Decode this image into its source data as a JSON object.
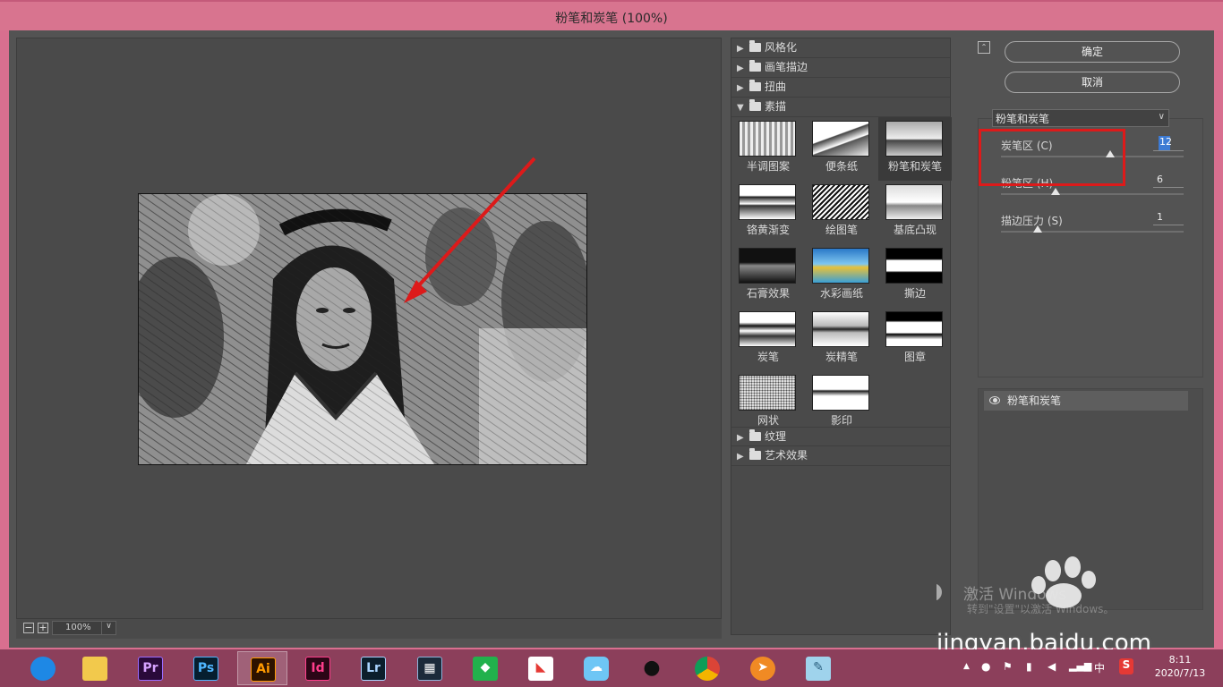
{
  "window": {
    "title": "粉笔和炭笔 (100%)"
  },
  "preview": {
    "zoom": "100%"
  },
  "gallery": {
    "categories_top": [
      {
        "label": "风格化",
        "expanded": false
      },
      {
        "label": "画笔描边",
        "expanded": false
      },
      {
        "label": "扭曲",
        "expanded": false
      },
      {
        "label": "素描",
        "expanded": true
      }
    ],
    "thumbnails": [
      {
        "label": "半调图案"
      },
      {
        "label": "便条纸"
      },
      {
        "label": "粉笔和炭笔",
        "selected": true
      },
      {
        "label": "铬黄渐变"
      },
      {
        "label": "绘图笔"
      },
      {
        "label": "基底凸现"
      },
      {
        "label": "石膏效果"
      },
      {
        "label": "水彩画纸"
      },
      {
        "label": "撕边"
      },
      {
        "label": "炭笔"
      },
      {
        "label": "炭精笔"
      },
      {
        "label": "图章"
      },
      {
        "label": "网状"
      },
      {
        "label": "影印"
      }
    ],
    "categories_bottom": [
      {
        "label": "纹理",
        "expanded": false
      },
      {
        "label": "艺术效果",
        "expanded": false
      }
    ]
  },
  "buttons": {
    "ok": "确定",
    "cancel": "取消"
  },
  "filter_select": "粉笔和炭笔",
  "params": [
    {
      "label": "炭笔区 (C)",
      "value": "12",
      "slider_fraction": 0.6
    },
    {
      "label": "粉笔区 (H)",
      "value": "6",
      "slider_fraction": 0.3
    },
    {
      "label": "描边压力 (S)",
      "value": "1",
      "slider_fraction": 0.2
    }
  ],
  "effect_layer": {
    "label": "粉笔和炭笔"
  },
  "watermark": {
    "activate_windows": "激活 Windows",
    "activate_sub": "转到\"设置\"以激活 Windows。",
    "baidu_url": "jingyan.baidu.com"
  },
  "taskbar": {
    "apps": [
      "browser",
      "file-explorer",
      "premiere",
      "photoshop",
      "illustrator",
      "indesign",
      "lightroom",
      "video-editor",
      "green-app",
      "colorful-app",
      "cloud-app",
      "qq",
      "chrome",
      "sparrow-app",
      "notes-app"
    ],
    "clock_time": "8:11",
    "clock_date": "2020/7/13",
    "ime": "中"
  },
  "colors": {
    "accent_red": "#dd1a1a",
    "window_frame": "#d8748f",
    "taskbar": "#8c3f5b"
  }
}
